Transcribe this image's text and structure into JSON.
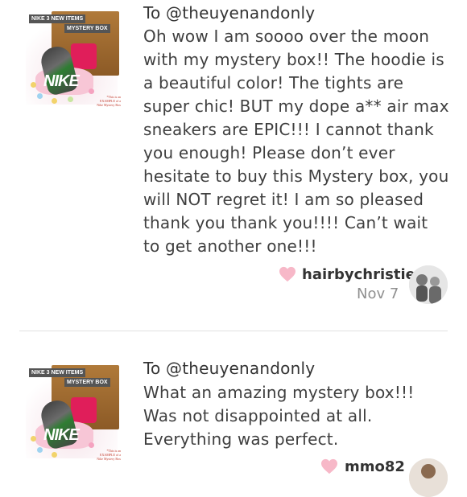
{
  "notes": [
    {
      "thumbnail": {
        "tag_top": "NIKE 3 NEW ITEMS",
        "tag_box": "MYSTERY BOX",
        "fine_print": "*This is an EXAMPLE of a Nike Mystery Box"
      },
      "recipient": "To @theuyenandonly",
      "message": "Oh wow I am soooo over the moon with my mystery box!! The hoodie is a beautiful color! The tights are super chic! BUT my dope a** air max sneakers are EPIC!!! I cannot thank you enough! Please don’t ever hesitate to buy this Mystery box, you will NOT regret it! I am so pleased thank you thank you!!!! Can’t wait to get another one!!!",
      "username": "hairbychristie",
      "date": "Nov 7",
      "heart_color": "#f7b8c8"
    },
    {
      "thumbnail": {
        "tag_top": "NIKE 3 NEW ITEMS",
        "tag_box": "MYSTERY BOX",
        "fine_print": "*This is an EXAMPLE of a Nike Mystery Box"
      },
      "recipient": "To @theuyenandonly",
      "message": "What an amazing mystery box!!! Was not disappointed at all. Everything was perfect.",
      "username": "mmo82",
      "date": "",
      "heart_color": "#f7b8c8"
    }
  ]
}
